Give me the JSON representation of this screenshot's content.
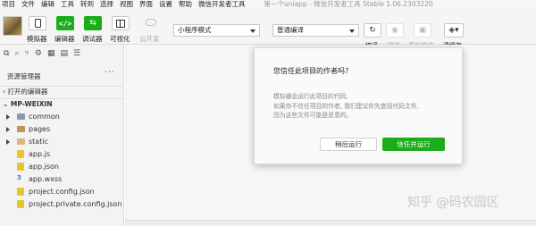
{
  "menu": {
    "items": [
      "项目",
      "文件",
      "编辑",
      "工具",
      "转到",
      "选择",
      "视图",
      "界面",
      "设置",
      "帮助",
      "微信开发者工具"
    ],
    "window_title": "第一个uniapp - 微信开发者工具 Stable 1.06.2303220"
  },
  "toolbar": {
    "simulator_label": "模拟器",
    "editor_label": "编辑器",
    "debugger_label": "调试器",
    "visual_label": "可视化",
    "cloud_label": "云开发",
    "mode_select": "小程序模式",
    "compile_select": "普通编译",
    "compile_label": "编译",
    "preview_label": "预览",
    "device_debug_label": "真机调试",
    "clear_cache_label": "清缓存"
  },
  "explorer": {
    "title": "资源管理器",
    "more": "···",
    "open_editors": "打开的编辑器",
    "project": "MP-WEIXIN",
    "tree": [
      {
        "name": "common",
        "type": "folder-grey",
        "expandable": true
      },
      {
        "name": "pages",
        "type": "folder-brown",
        "expandable": true
      },
      {
        "name": "static",
        "type": "folder-yellow",
        "expandable": true
      },
      {
        "name": "app.js",
        "type": "js",
        "expandable": false
      },
      {
        "name": "app.json",
        "type": "json",
        "expandable": false
      },
      {
        "name": "app.wxss",
        "type": "wxss",
        "expandable": false
      },
      {
        "name": "project.config.json",
        "type": "json",
        "expandable": false
      },
      {
        "name": "project.private.config.json",
        "type": "json",
        "expandable": false
      }
    ]
  },
  "dialog": {
    "title": "您信任此项目的作者吗?",
    "body_lines": [
      "模拟器会运行此项目的代码,",
      "如果你不信任项目的作者, 我们建议你先查阅代码文件,",
      "因为这些文件可能是恶意的。"
    ],
    "later_button": "稍后运行",
    "trust_button": "信任并运行"
  },
  "watermark": "知乎 @码农园区",
  "colors": {
    "accent_green": "#1aad19"
  }
}
